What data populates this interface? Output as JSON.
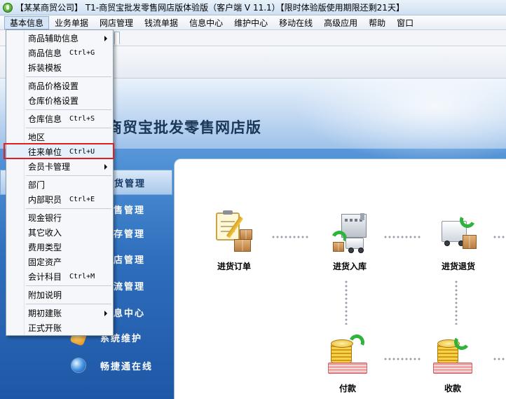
{
  "window": {
    "title": "【某某商贸公司】 T1-商贸宝批发零售网店版体验版（客户端 V 11.1）【限时体验版使用期限还剩21天】"
  },
  "menubar": {
    "items": [
      "基本信息",
      "业务单据",
      "网店管理",
      "钱流单据",
      "信息中心",
      "维护中心",
      "移动在线",
      "高级应用",
      "帮助",
      "窗口"
    ]
  },
  "banner": {
    "title": "商贸宝批发零售网店版"
  },
  "nav": {
    "items": [
      {
        "label": "货管理",
        "selected": true
      },
      {
        "label": "售管理"
      },
      {
        "label": "存管理"
      },
      {
        "label": "店管理"
      },
      {
        "label": "流管理"
      },
      {
        "label": "息中心"
      },
      {
        "label": "系统维护",
        "icon": "tools-icon"
      },
      {
        "label": "畅捷通在线",
        "icon": "globe-icon"
      }
    ]
  },
  "flow": {
    "purchase_order": "进货订单",
    "purchase_receipt": "进货入库",
    "purchase_return": "进货退货",
    "payment": "付款",
    "receipt": "收款"
  },
  "dropdown": {
    "items": [
      {
        "label": "商品辅助信息",
        "submenu": true
      },
      {
        "label": "商品信息",
        "shortcut": "Ctrl+G"
      },
      {
        "label": "拆装模板"
      },
      {
        "label": "商品价格设置"
      },
      {
        "label": "仓库价格设置"
      },
      {
        "label": "仓库信息",
        "shortcut": "Ctrl+S"
      },
      {
        "label": "地区"
      },
      {
        "label": "往来单位",
        "shortcut": "Ctrl+U",
        "highlighted": true
      },
      {
        "label": "会员卡管理",
        "submenu": true
      },
      {
        "label": "部门"
      },
      {
        "label": "内部职员",
        "shortcut": "Ctrl+E"
      },
      {
        "label": "现金银行"
      },
      {
        "label": "其它收入"
      },
      {
        "label": "费用类型"
      },
      {
        "label": "固定资产"
      },
      {
        "label": "会计科目",
        "shortcut": "Ctrl+M"
      },
      {
        "label": "附加说明"
      },
      {
        "label": "期初建账",
        "submenu": true
      },
      {
        "label": "正式开账"
      }
    ]
  },
  "colors": {
    "highlight_border": "#e02020",
    "workspace_blue": "#2f6fbd"
  }
}
